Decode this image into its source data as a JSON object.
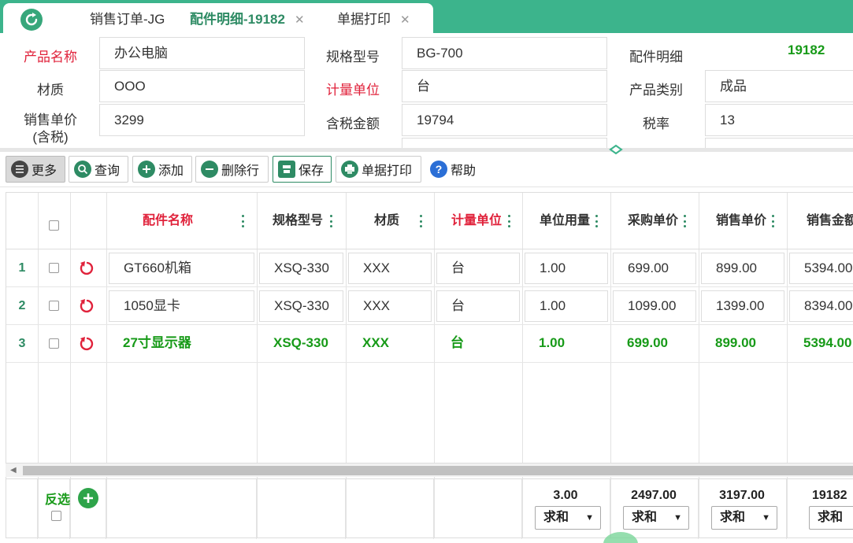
{
  "tabs": [
    {
      "label": "销售订单-JG",
      "closable": false
    },
    {
      "label": "配件明细-19182",
      "closable": true,
      "active": true
    },
    {
      "label": "单据打印",
      "closable": true
    }
  ],
  "form": {
    "product_name_label": "产品名称",
    "product_name_value": "办公电脑",
    "spec_label": "规格型号",
    "spec_value": "BG-700",
    "detail_label": "配件明细",
    "detail_value": "19182",
    "material_label": "材质",
    "material_value": "OOO",
    "unit_label": "计量单位",
    "unit_value": "台",
    "category_label": "产品类别",
    "category_value": "成品",
    "price_label_line1": "销售单价",
    "price_label_line2": "(含税)",
    "price_value": "3299",
    "tax_amount_label": "含税金额",
    "tax_amount_value": "19794",
    "tax_rate_label": "税率",
    "tax_rate_value": "13"
  },
  "toolbar": {
    "more": "更多",
    "query": "查询",
    "add": "添加",
    "delete_row": "删除行",
    "save": "保存",
    "print": "单据打印",
    "help": "帮助"
  },
  "grid": {
    "headers": [
      "配件名称",
      "规格型号",
      "材质",
      "计量单位",
      "单位用量",
      "采购单价",
      "销售单价",
      "销售金额"
    ],
    "rows": [
      {
        "num": "1",
        "name": "GT660机箱",
        "spec": "XSQ-330",
        "material": "XXX",
        "unit": "台",
        "usage": "1.00",
        "purchase": "699.00",
        "sale": "899.00",
        "amount": "5394.00"
      },
      {
        "num": "2",
        "name": "1050显卡",
        "spec": "XSQ-330",
        "material": "XXX",
        "unit": "台",
        "usage": "1.00",
        "purchase": "1099.00",
        "sale": "1399.00",
        "amount": "8394.00"
      },
      {
        "num": "3",
        "name": "27寸显示器",
        "spec": "XSQ-330",
        "material": "XXX",
        "unit": "台",
        "usage": "1.00",
        "purchase": "699.00",
        "sale": "899.00",
        "amount": "5394.00"
      }
    ]
  },
  "footer": {
    "reverse_label": "反选",
    "sums": [
      "3.00",
      "2497.00",
      "3197.00",
      "19182"
    ],
    "agg_label": "求和"
  },
  "colors": {
    "accent": "#3cb48c",
    "required": "#e0223b",
    "selected_text": "#179a18"
  }
}
